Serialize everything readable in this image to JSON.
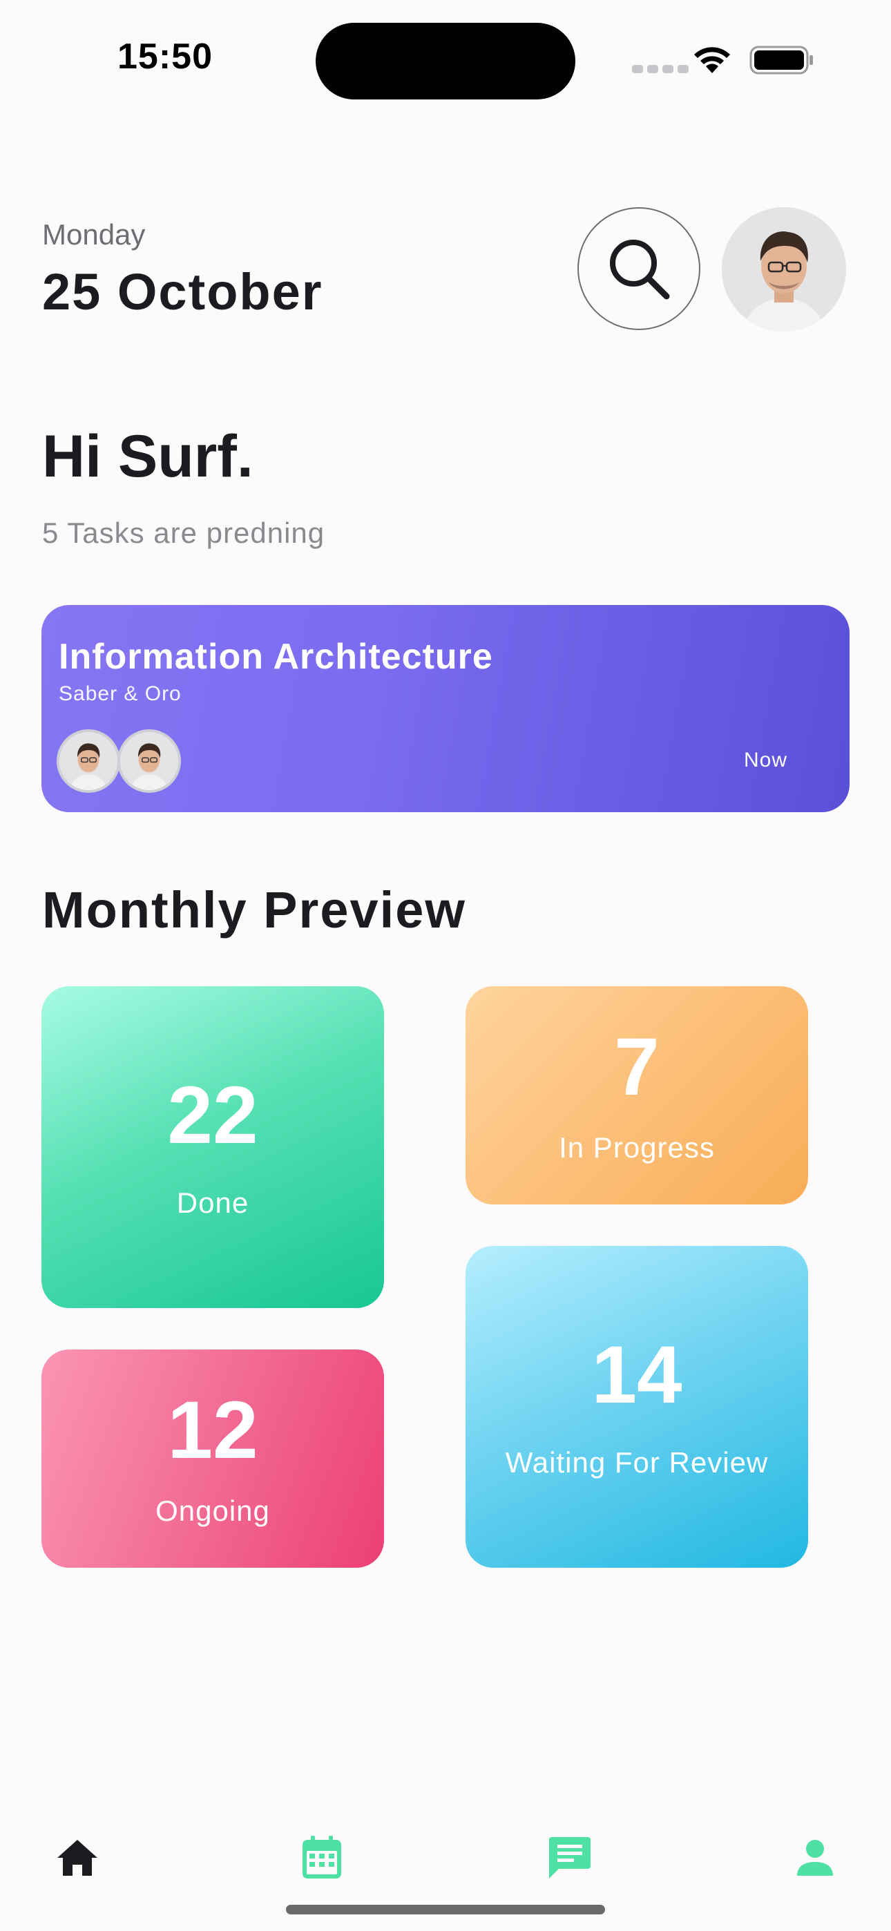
{
  "status_bar": {
    "time": "15:50"
  },
  "header": {
    "day": "Monday",
    "date": "25 October",
    "search_icon": "search-icon",
    "avatar_icon": "user-avatar"
  },
  "greeting": {
    "title": "Hi Surf.",
    "subtitle": "5 Tasks are predning"
  },
  "task_card": {
    "title": "Information Architecture",
    "members": "Saber & Oro",
    "time": "Now",
    "colors": [
      "#8676f3",
      "#5a50d8"
    ]
  },
  "monthly_preview": {
    "title": "Monthly Preview",
    "tiles": [
      {
        "value": "22",
        "label": "Done",
        "color": "#17c793"
      },
      {
        "value": "7",
        "label": "In Progress",
        "color": "#f8ad56"
      },
      {
        "value": "12",
        "label": "Ongoing",
        "color": "#ec3f75"
      },
      {
        "value": "14",
        "label": "Waiting For Review",
        "color": "#21b8e2"
      }
    ]
  },
  "bottom_nav": {
    "items": [
      {
        "icon": "home-icon",
        "active": true
      },
      {
        "icon": "calendar-icon",
        "active": false
      },
      {
        "icon": "chat-icon",
        "active": false
      },
      {
        "icon": "profile-icon",
        "active": false
      }
    ],
    "accent_color": "#4ee1a3",
    "active_color": "#1d1b20"
  }
}
